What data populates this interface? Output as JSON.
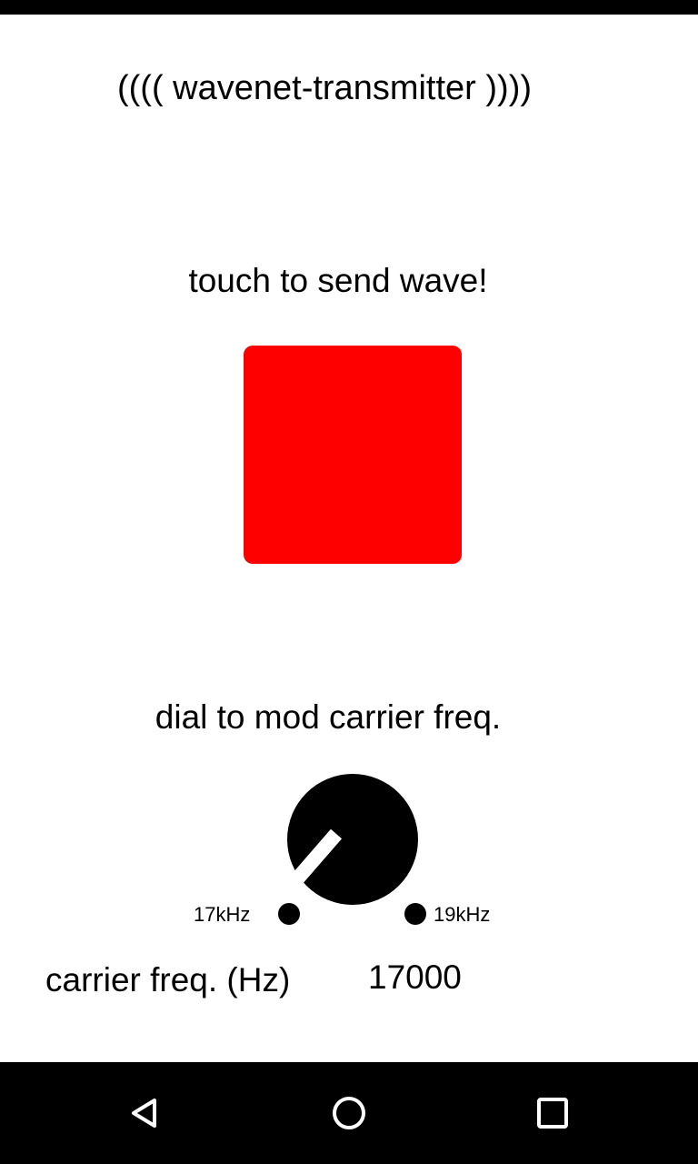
{
  "app": {
    "title": "(((( wavenet-transmitter ))))"
  },
  "send": {
    "label": "touch to send wave!",
    "button_color": "#ff0000"
  },
  "dial": {
    "label": "dial to mod carrier freq.",
    "min_label": "17kHz",
    "max_label": "19kHz"
  },
  "carrier": {
    "label": "carrier freq. (Hz)",
    "value": "17000"
  },
  "navbar": {
    "icons": [
      "back-icon",
      "home-icon",
      "recent-apps-icon"
    ]
  }
}
